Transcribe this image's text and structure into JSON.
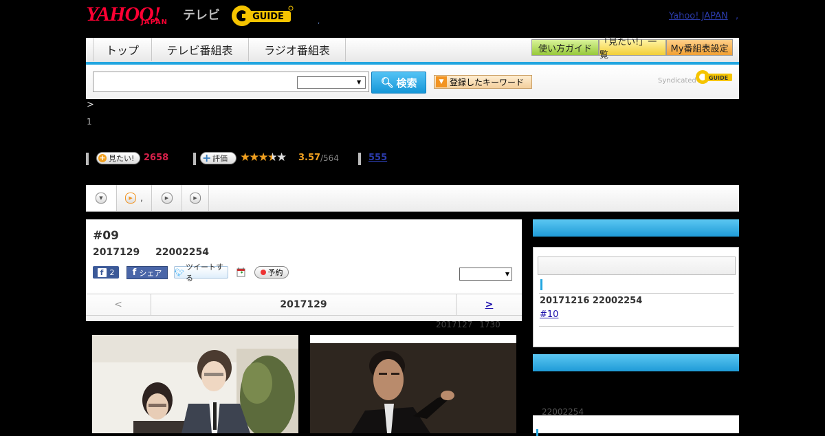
{
  "header": {
    "logo_yahoo": "YAHOO!",
    "logo_japan": "JAPAN",
    "logo_tv": "テレビ",
    "logo_guide": "GUIDE",
    "yahoo_japan_link": "Yahoo! JAPAN",
    "sep": ","
  },
  "nav": {
    "tabs": [
      "トップ",
      "テレビ番組表",
      "ラジオ番組表"
    ],
    "buttons": [
      "使い方ガイド",
      "「見たい!」一覧",
      "My番組表設定"
    ]
  },
  "search": {
    "input_value": "",
    "select_value": "",
    "button_label": "検索",
    "keyword_button": "登録したキーワード",
    "syndicated": "Syndicated"
  },
  "breadcrumb": ">",
  "page_index": "1",
  "stats": {
    "want_label": "見たい!",
    "want_count": "2658",
    "rate_label": "評価",
    "stars": "★★★★★",
    "rating": "3.57",
    "rating_count": "/564",
    "review_link": "555"
  },
  "tabs": [
    "",
    ",",
    "",
    ""
  ],
  "program": {
    "episode": "#09",
    "airtime": "2017129 22002254",
    "fb_count": "2",
    "fb_share": "シェア",
    "tweet": "ツイートする",
    "reserve": "予約",
    "select_value": "",
    "pager_prev": "<",
    "pager_current": "2017129",
    "pager_next": ">",
    "updated": "2017127 1730"
  },
  "sidebar": {
    "next_airtime": "20171216 22002254",
    "next_episode": "#10",
    "time2": "22002254"
  },
  "colors": {
    "accent": "#22a6e0",
    "want_count": "#d6204a",
    "rating": "#f0a020"
  }
}
